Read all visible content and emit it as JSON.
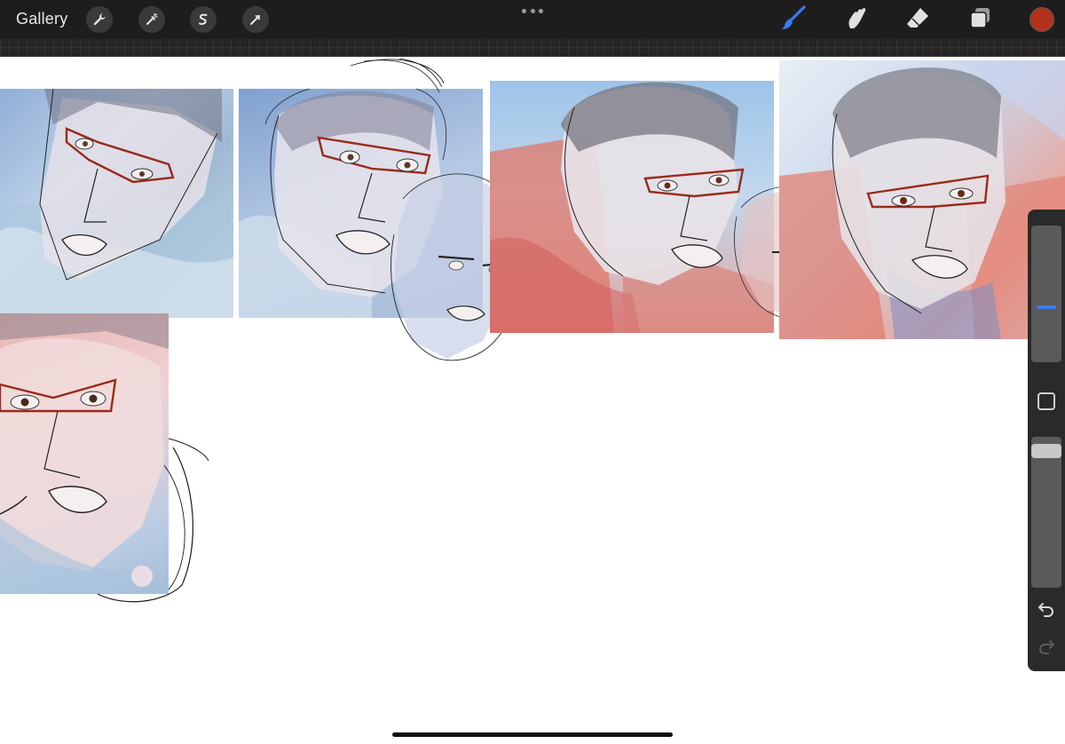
{
  "toolbar": {
    "gallery_label": "Gallery",
    "left_tools": [
      "wrench-icon",
      "magic-wand-icon",
      "selection-icon",
      "transform-arrow-icon"
    ],
    "right_tools": [
      "brush-icon",
      "smudge-icon",
      "eraser-icon",
      "layers-icon"
    ],
    "active_tool": "brush",
    "active_color": "#b3321b",
    "accent_color": "#3a7bf0"
  },
  "sidebar": {
    "brush_size_level": 0.4,
    "opacity_level": 0.05,
    "modifier_icon": "square-modifier-icon",
    "undo_icon": "undo-icon",
    "redo_icon": "redo-icon",
    "redo_enabled": false
  },
  "canvas": {
    "background": "#ffffff",
    "sketch_color": "#1a1a1a",
    "glasses_color": "#9a2a1a"
  }
}
